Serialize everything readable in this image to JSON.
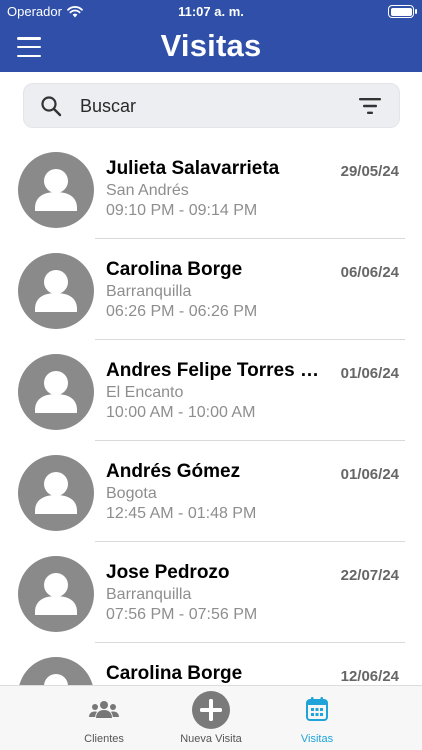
{
  "status_bar": {
    "carrier": "Operador",
    "time": "11:07 a. m."
  },
  "header": {
    "title": "Visitas",
    "menu_icon": "hamburger-menu-icon"
  },
  "search": {
    "placeholder": "Buscar",
    "search_icon": "search-icon",
    "filter_icon": "filter-icon"
  },
  "visits": [
    {
      "name": "Julieta Salavarrieta",
      "city": "San Andrés",
      "time": "09:10 PM - 09:14 PM",
      "date": "29/05/24"
    },
    {
      "name": "Carolina Borge",
      "city": "Barranquilla",
      "time": "06:26 PM - 06:26 PM",
      "date": "06/06/24"
    },
    {
      "name": "Andres Felipe Torres Castro",
      "city": "El Encanto",
      "time": "10:00 AM - 10:00 AM",
      "date": "01/06/24"
    },
    {
      "name": "Andrés Gómez",
      "city": "Bogota",
      "time": "12:45 AM - 01:48 PM",
      "date": "01/06/24"
    },
    {
      "name": "Jose Pedrozo",
      "city": "Barranquilla",
      "time": "07:56 PM - 07:56 PM",
      "date": "22/07/24"
    },
    {
      "name": "Carolina Borge",
      "city": "",
      "time": "",
      "date": "12/06/24"
    }
  ],
  "tabbar": {
    "clientes": {
      "label": "Clientes",
      "icon": "people-icon"
    },
    "nueva_visita": {
      "label": "Nueva Visita",
      "icon": "plus-circle-icon"
    },
    "visitas": {
      "label": "Visitas",
      "icon": "calendar-icon"
    }
  },
  "colors": {
    "header": "#2f4fa8",
    "active_tab": "#1fa3d9",
    "avatar": "#8a8a8a"
  }
}
